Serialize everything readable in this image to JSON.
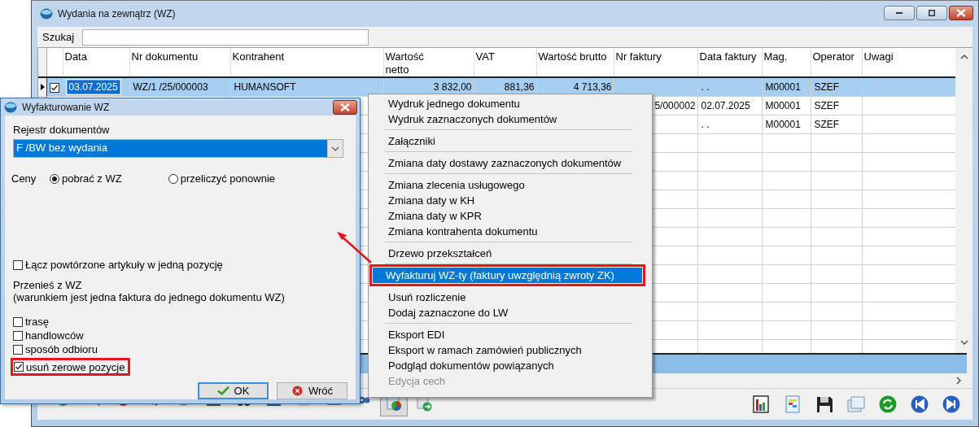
{
  "window": {
    "title": "Wydania na zewnątrz (WZ)"
  },
  "search": {
    "label": "Szukaj"
  },
  "table": {
    "columns": [
      "Data",
      "Nr dokumentu",
      "Kontrahent",
      "Wartość\nnetto",
      "VAT",
      "Wartość brutto",
      "Nr faktury",
      "Data faktury",
      "Mag.",
      "Operator",
      "Uwagi"
    ],
    "rows": [
      {
        "current": true,
        "selected": true,
        "checked": true,
        "cells": [
          "03.07.2025",
          "WZ/1  /25/000003",
          "HUMANSOFT",
          "3 832,00",
          "881,36",
          "4 713,36",
          null,
          ". .",
          "M00001",
          "SZEF",
          null
        ]
      },
      {
        "selected": false,
        "cells": [
          null,
          null,
          null,
          null,
          null,
          null,
          "5/000002",
          "02.07.2025",
          "M00001",
          "SZEF",
          null
        ]
      },
      {
        "selected": false,
        "cells": [
          null,
          null,
          null,
          null,
          null,
          null,
          null,
          ". .",
          "M00001",
          "SZEF",
          null
        ]
      }
    ]
  },
  "toolbar": {
    "left": [
      {
        "pressed": false
      },
      {
        "pressed": false
      },
      {
        "pressed": false
      },
      {
        "pressed": false
      },
      {
        "pressed": false
      },
      {
        "pressed": false
      },
      {
        "pressed": false
      },
      {
        "pressed": false
      },
      {
        "pressed": false
      },
      {
        "pressed": false
      },
      {
        "pressed": false
      },
      {
        "pressed": true
      },
      {
        "pressed": false
      }
    ],
    "right": [
      {
        "pressed": false
      },
      {
        "pressed": false
      },
      {
        "pressed": false
      },
      {
        "pressed": false
      },
      {
        "pressed": false
      },
      {
        "pressed": false
      },
      {
        "pressed": false
      }
    ]
  },
  "context_menu": {
    "groups": [
      [
        {
          "label": "Wydruk jednego dokumentu",
          "selected": false,
          "disabled": false,
          "highlighted": false
        },
        {
          "label": "Wydruk zaznaczonych dokumentów",
          "selected": false,
          "disabled": false,
          "highlighted": false
        }
      ],
      [
        {
          "label": "Załączniki",
          "selected": false,
          "disabled": false,
          "highlighted": false
        }
      ],
      [
        {
          "label": "Zmiana daty dostawy zaznaczonych dokumentów",
          "selected": false,
          "disabled": false,
          "highlighted": false
        }
      ],
      [
        {
          "label": "Zmiana zlecenia usługowego",
          "selected": false,
          "disabled": false,
          "highlighted": false
        },
        {
          "label": "Zmiana daty w KH",
          "selected": false,
          "disabled": false,
          "highlighted": false
        },
        {
          "label": "Zmiana daty w KPR",
          "selected": false,
          "disabled": false,
          "highlighted": false
        },
        {
          "label": "Zmiana kontrahenta dokumentu",
          "selected": false,
          "disabled": false,
          "highlighted": false
        }
      ],
      [
        {
          "label": "Drzewo przekształceń",
          "selected": false,
          "disabled": false,
          "highlighted": false
        }
      ],
      [
        {
          "label": "Wyfakturuj WZ-ty (faktury uwzględnią zwroty ZK)",
          "selected": true,
          "disabled": false,
          "highlighted": true
        }
      ],
      [
        {
          "label": "Usuń rozliczenie",
          "selected": false,
          "disabled": false,
          "highlighted": false
        },
        {
          "label": "Dodaj zaznaczone do LW",
          "selected": false,
          "disabled": false,
          "highlighted": false
        }
      ],
      [
        {
          "label": "Eksport EDI",
          "selected": false,
          "disabled": false,
          "highlighted": false
        },
        {
          "label": "Eksport w ramach zamówień publicznych",
          "selected": false,
          "disabled": false,
          "highlighted": false
        },
        {
          "label": "Podgląd dokumentów powiązanych",
          "selected": false,
          "disabled": false,
          "highlighted": false
        },
        {
          "label": "Edycja cech",
          "selected": false,
          "disabled": true,
          "highlighted": false
        }
      ]
    ]
  },
  "dialog": {
    "title": "Wyfakturowanie WZ",
    "register_label": "Rejestr dokumentów",
    "register_value": "F /BW bez wydania",
    "prices_label": "Ceny",
    "price_options": [
      {
        "label": "pobrać z WZ",
        "selected": true
      },
      {
        "label": "przeliczyć ponownie",
        "selected": false
      }
    ],
    "merge": {
      "label": "Łącz powtórzone artykuły w jedną pozycję",
      "checked": false
    },
    "transfer_title": "Przenieś z WZ",
    "transfer_note": "(warunkiem jest jedna faktura do jednego dokumentu WZ)",
    "transfer_options": [
      {
        "label": "trasę",
        "checked": false,
        "highlighted": false
      },
      {
        "label": "handlowców",
        "checked": false,
        "highlighted": false
      },
      {
        "label": "sposób odbioru",
        "checked": false,
        "highlighted": false
      },
      {
        "label": "usuń zerowe pozycje",
        "checked": true,
        "highlighted": true
      }
    ],
    "buttons": [
      {
        "label": "OK",
        "kind": "ok",
        "default": true
      },
      {
        "label": "Wróć",
        "kind": "back",
        "default": false
      }
    ]
  }
}
